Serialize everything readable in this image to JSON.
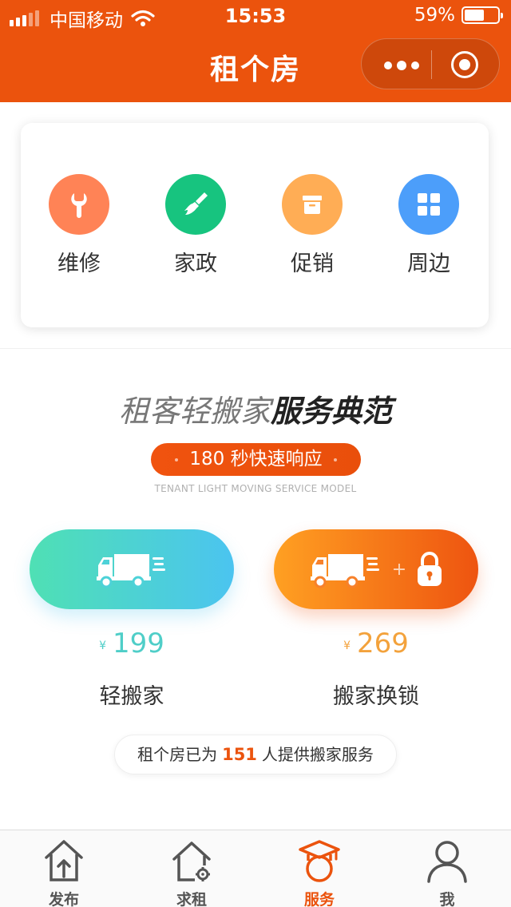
{
  "status_bar": {
    "carrier": "中国移动",
    "time": "15:53",
    "battery": "59%",
    "battery_level": 0.59
  },
  "nav": {
    "title": "租个房",
    "more_icon": "ellipsis-icon",
    "close_icon": "target-icon"
  },
  "services": [
    {
      "label": "维修",
      "icon": "wrench-icon",
      "color": "#FF8356"
    },
    {
      "label": "家政",
      "icon": "broom-icon",
      "color": "#17C47F"
    },
    {
      "label": "促销",
      "icon": "box-icon",
      "color": "#FFAD55"
    },
    {
      "label": "周边",
      "icon": "grid-icon",
      "color": "#4C9EFA"
    }
  ],
  "promo": {
    "slogan_light": "租客轻搬家",
    "slogan_bold": "服务典范",
    "badge": "180 秒快速响应",
    "subtitle": "TENANT LIGHT MOVING SERVICE MODEL"
  },
  "moving": [
    {
      "name": "轻搬家",
      "currency": "¥",
      "price": "199",
      "icon": "truck-icon"
    },
    {
      "name": "搬家换锁",
      "currency": "¥",
      "price": "269",
      "icon": "truck-lock-icon",
      "plus": "+"
    }
  ],
  "served": {
    "prefix": "租个房已为",
    "count": "151",
    "suffix": "人提供搬家服务"
  },
  "tabs": [
    {
      "label": "发布",
      "icon": "house-upload-icon",
      "active": false
    },
    {
      "label": "求租",
      "icon": "house-gear-icon",
      "active": false
    },
    {
      "label": "服务",
      "icon": "graduation-cap-icon",
      "active": true
    },
    {
      "label": "我",
      "icon": "person-icon",
      "active": false
    }
  ],
  "colors": {
    "brand": "#EB530D",
    "tab_active": "#EB530D"
  }
}
